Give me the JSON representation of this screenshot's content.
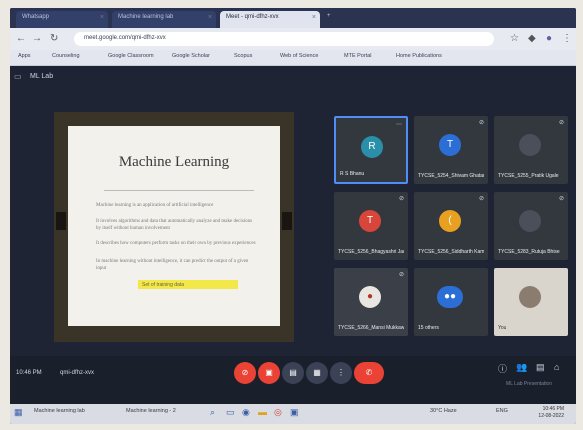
{
  "browser": {
    "tabs": [
      {
        "label": "Whatsapp"
      },
      {
        "label": "Machine learning lab"
      },
      {
        "label": "Meet - qmi-dfhz-xvx"
      }
    ],
    "url": "meet.google.com/qmi-dfhz-xvx",
    "bookmarks": [
      "Apps",
      "Counseling",
      "Google Classroom",
      "Google Scholar",
      "Scopus",
      "Web of Science",
      "MTE Portal",
      "Home Publications"
    ]
  },
  "meeting": {
    "title": "ML Lab",
    "time": "10:46 PM",
    "meeting_code": "qmi-dfhz-xvx",
    "attribution": "ML Lab Presentation"
  },
  "slide": {
    "title": "Machine Learning",
    "bullets": [
      "Machine learning is an application of artificial intelligence",
      "It involves algorithms and data that automatically analyze and make decisions by itself without human involvement",
      "It describes how computers perform tasks on their own by previous experiences",
      "In machine learning without intelligence, it can predict the output of a given input"
    ],
    "highlight": "Set of training data"
  },
  "participants": [
    {
      "initial": "R",
      "name": "R S Bhanu",
      "color": "#2a8fa8",
      "speaking": true
    },
    {
      "initial": "T",
      "name": "TYCSE_5254_Shivam Ghatare",
      "color": "#2b6fd6",
      "speaking": false
    },
    {
      "initial": "",
      "name": "TYCSE_5255_Pratik Ugale",
      "color": "#4a4f59",
      "speaking": false
    },
    {
      "initial": "T",
      "name": "TYCSE_5256_Bhagyashri Jadhav",
      "color": "#d8453b",
      "speaking": false
    },
    {
      "initial": "(",
      "name": "TYCSE_5256_Siddharth Kamble",
      "color": "#e8a020",
      "speaking": false
    },
    {
      "initial": "",
      "name": "TYCSE_5283_Rutuja Bhise",
      "color": "#4a4f59",
      "speaking": false
    },
    {
      "initial": "",
      "name": "TYCSE_5266_Mansi Mukkawar",
      "color": "#e9e6e1",
      "speaking": false
    },
    {
      "initial": "",
      "name": "15 others",
      "color": "#2b6fd6",
      "speaking": false
    },
    {
      "initial": "",
      "name": "You",
      "color": "#d9d4cc",
      "speaking": false
    }
  ],
  "controls": [
    {
      "name": "mic-off",
      "glyph": "⊘",
      "color": "#ea4335"
    },
    {
      "name": "camera-off",
      "glyph": "▣",
      "color": "#ea4335"
    },
    {
      "name": "captions",
      "glyph": "▤",
      "color": "#3c4256"
    },
    {
      "name": "present",
      "glyph": "▦",
      "color": "#3c4256"
    },
    {
      "name": "more",
      "glyph": "⋮",
      "color": "#3c4256"
    },
    {
      "name": "leave",
      "glyph": "✆",
      "color": "#ea4335"
    }
  ],
  "taskbar": {
    "items": [
      "Machine learning lab",
      "Machine learning - 2"
    ],
    "weather": "30°C Haze",
    "lang": "ENG",
    "time": "10:46 PM",
    "date": "12-08-2022"
  }
}
